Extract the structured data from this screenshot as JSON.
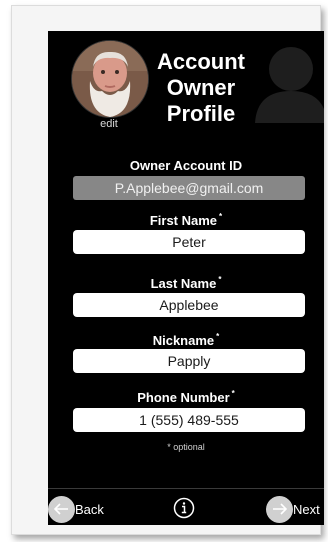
{
  "profile": {
    "title_lines": [
      "Account",
      "Owner",
      "Profile"
    ],
    "edit_label": "edit"
  },
  "fields": {
    "account_id": {
      "label": "Owner Account ID",
      "value": "P.Applebee@gmail.com"
    },
    "first_name": {
      "label": "First Name",
      "value": "Peter",
      "marker": "*"
    },
    "last_name": {
      "label": "Last Name",
      "value": "Applebee",
      "marker": "*"
    },
    "nickname": {
      "label": "Nickname",
      "value": "Papply",
      "marker": "*"
    },
    "phone": {
      "label": "Phone Number",
      "value": "1 (555) 489-555",
      "marker": "*"
    }
  },
  "optional_note": "* optional",
  "nav": {
    "back_label": "Back",
    "next_label": "Next",
    "info_icon": "info-icon",
    "back_icon": "arrow-left-icon",
    "next_icon": "arrow-right-icon"
  },
  "colors": {
    "screen_bg": "#000000",
    "readonly_field": "#878787",
    "input_bg": "#ffffff",
    "nav_circle": "#d0d0d0"
  }
}
